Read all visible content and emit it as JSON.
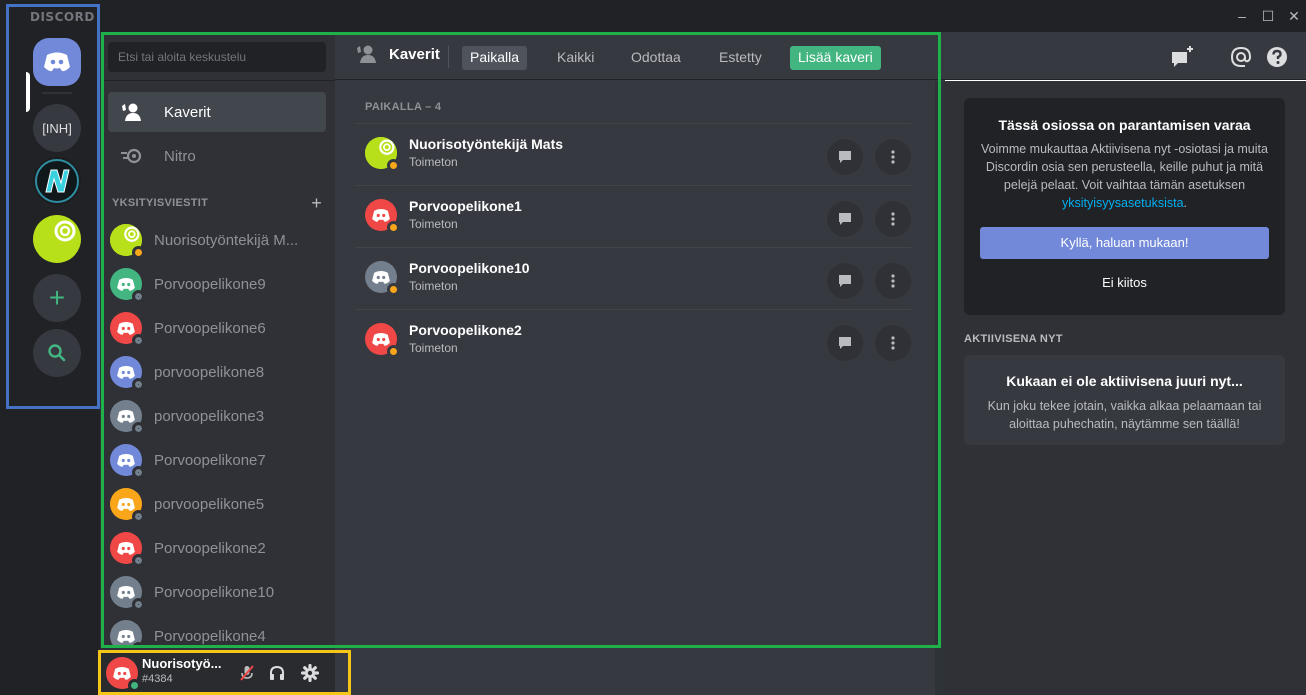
{
  "app": {
    "logo": "DISCORD",
    "window_controls": [
      "–",
      "☐",
      "✕"
    ]
  },
  "servers": [
    {
      "label": "",
      "icon": "discord-home-icon"
    },
    {
      "label": "[INH]",
      "icon": ""
    },
    {
      "label": "",
      "icon": "n-server-icon"
    },
    {
      "label": "",
      "icon": "lime-server-icon"
    },
    {
      "label": "+",
      "icon": "add-server-icon"
    },
    {
      "label": "",
      "icon": "explore-icon"
    }
  ],
  "sidebar": {
    "search_placeholder": "Etsi tai aloita keskustelu",
    "nav": [
      {
        "label": "Kaverit",
        "icon": "friends-icon",
        "active": true
      },
      {
        "label": "Nitro",
        "icon": "nitro-icon",
        "active": false
      }
    ],
    "dm_header": "YKSITYISVIESTIT",
    "dm_add": "+",
    "dms": [
      {
        "name": "Nuorisotyöntekijä M...",
        "avatar_color": "#b8e01a",
        "status": "idle"
      },
      {
        "name": "Porvoopelikone9",
        "avatar_color": "#43b581",
        "status": "offline"
      },
      {
        "name": "Porvoopelikone6",
        "avatar_color": "#f04747",
        "status": "offline"
      },
      {
        "name": "porvoopelikone8",
        "avatar_color": "#7289da",
        "status": "offline"
      },
      {
        "name": "porvoopelikone3",
        "avatar_color": "#747f8d",
        "status": "offline"
      },
      {
        "name": "Porvoopelikone7",
        "avatar_color": "#7289da",
        "status": "offline"
      },
      {
        "name": "porvoopelikone5",
        "avatar_color": "#faa61a",
        "status": "offline"
      },
      {
        "name": "Porvoopelikone2",
        "avatar_color": "#f04747",
        "status": "offline"
      },
      {
        "name": "Porvoopelikone10",
        "avatar_color": "#747f8d",
        "status": "offline"
      },
      {
        "name": "Porvoopelikone4",
        "avatar_color": "#747f8d",
        "status": "offline"
      }
    ]
  },
  "user_panel": {
    "name": "Nuorisotyö...",
    "tag": "#4384",
    "status": "online",
    "avatar_color": "#f04747"
  },
  "topbar": {
    "title": "Kaverit",
    "tabs": [
      {
        "label": "Paikalla",
        "active": true
      },
      {
        "label": "Kaikki",
        "active": false
      },
      {
        "label": "Odottaa",
        "active": false
      },
      {
        "label": "Estetty",
        "active": false
      }
    ],
    "add_friend": "Lisää kaveri",
    "icons": [
      "new-group-dm-icon",
      "mention-icon",
      "help-icon"
    ]
  },
  "friends": {
    "header": "PAIKALLA – 4",
    "rows": [
      {
        "name": "Nuorisotyöntekijä Mats",
        "status": "Toimeton",
        "avatar_color": "#b8e01a"
      },
      {
        "name": "Porvoopelikone1",
        "status": "Toimeton",
        "avatar_color": "#f04747"
      },
      {
        "name": "Porvoopelikone10",
        "status": "Toimeton",
        "avatar_color": "#747f8d"
      },
      {
        "name": "Porvoopelikone2",
        "status": "Toimeton",
        "avatar_color": "#f04747"
      }
    ]
  },
  "right_panel": {
    "privacy": {
      "title": "Tässä osiossa on parantamisen varaa",
      "body": "Voimme mukauttaa Aktiivisena nyt -osiotasi ja muita Discordin osia sen perusteella, keille puhut ja mitä pelejä pelaat. Voit vaihtaa tämän asetuksen",
      "link": "yksityisyysasetuksista",
      "body_end": ".",
      "accept": "Kyllä, haluan mukaan!",
      "decline": "Ei kiitos"
    },
    "active_header": "AKTIIVISENA NYT",
    "active_title": "Kukaan ei ole aktiivisena juuri nyt...",
    "active_body": "Kun joku tekee jotain, vaikka alkaa pelaamaan tai aloittaa puhechatin, näytämme sen täällä!"
  },
  "colors": {
    "blurple": "#7289da",
    "green": "#43b581",
    "idle": "#faa61a",
    "offline": "#747f8d",
    "annotation_blue": "#4472c4",
    "annotation_green": "#1fb14a",
    "annotation_yellow": "#f5c518"
  }
}
